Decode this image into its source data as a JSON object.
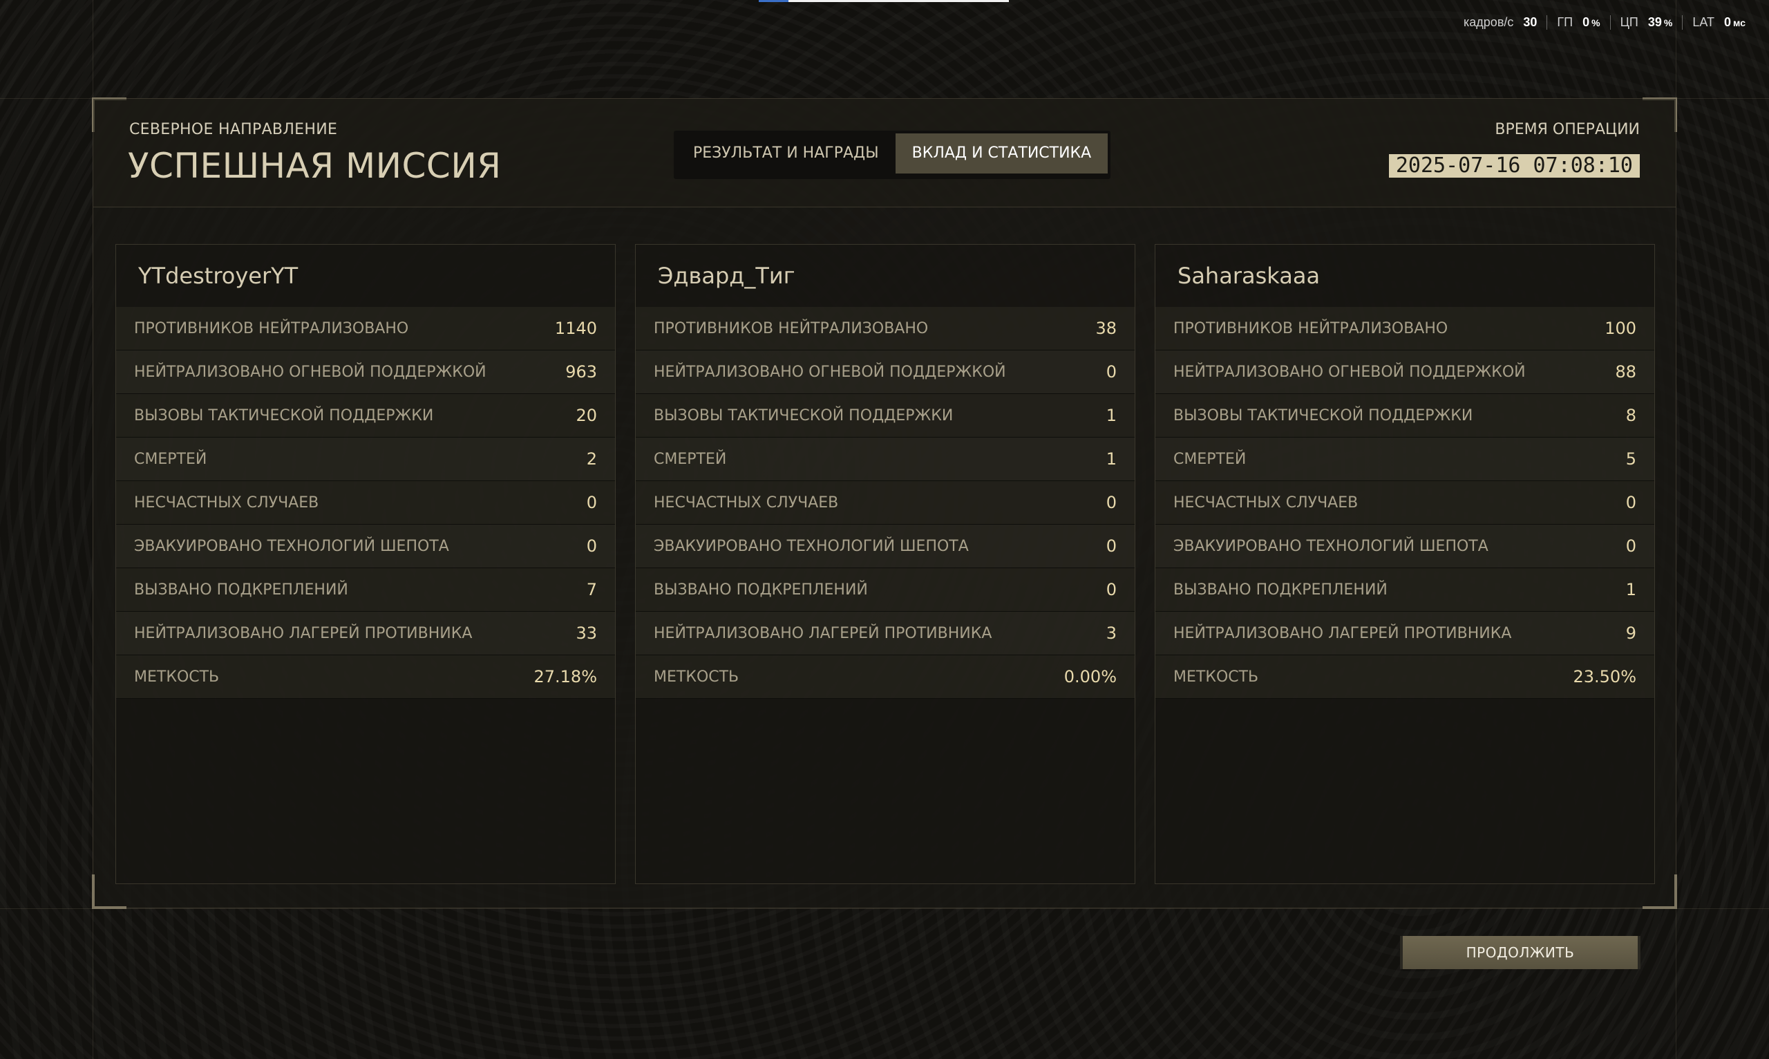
{
  "progress": {
    "fraction": 0.12
  },
  "perf": [
    {
      "label": "кадров/с",
      "value": "30",
      "unit": ""
    },
    {
      "label": "ГП",
      "value": "0",
      "unit": "%"
    },
    {
      "label": "ЦП",
      "value": "39",
      "unit": "%"
    },
    {
      "label": "LAT",
      "value": "0",
      "unit": "мс"
    }
  ],
  "header": {
    "subtitle": "СЕВЕРНОЕ НАПРАВЛЕНИЕ",
    "title": "УСПЕШНАЯ МИССИЯ",
    "op_time_label": "ВРЕМЯ ОПЕРАЦИИ",
    "op_time": "2025-07-16 07:08:10"
  },
  "tabs": [
    {
      "label": "РЕЗУЛЬТАТ И НАГРАДЫ",
      "active": false
    },
    {
      "label": "ВКЛАД И СТАТИСТИКА",
      "active": true
    }
  ],
  "players": [
    {
      "name": "YTdestroyerYT",
      "stats": [
        {
          "label": "Противников нейтрализовано",
          "value": "1140"
        },
        {
          "label": "Нейтрализовано огневой поддержкой",
          "value": "963"
        },
        {
          "label": "Вызовы тактической поддержки",
          "value": "20"
        },
        {
          "label": "Смертей",
          "value": "2"
        },
        {
          "label": "Несчастных случаев",
          "value": "0"
        },
        {
          "label": "Эвакуировано технологий шепота",
          "value": "0"
        },
        {
          "label": "Вызвано подкреплений",
          "value": "7"
        },
        {
          "label": "Нейтрализовано лагерей противника",
          "value": "33"
        },
        {
          "label": "Меткость",
          "value": "27.18%"
        }
      ]
    },
    {
      "name": "Эдвард_Тиг",
      "stats": [
        {
          "label": "Противников нейтрализовано",
          "value": "38"
        },
        {
          "label": "Нейтрализовано огневой поддержкой",
          "value": "0"
        },
        {
          "label": "Вызовы тактической поддержки",
          "value": "1"
        },
        {
          "label": "Смертей",
          "value": "1"
        },
        {
          "label": "Несчастных случаев",
          "value": "0"
        },
        {
          "label": "Эвакуировано технологий шепота",
          "value": "0"
        },
        {
          "label": "Вызвано подкреплений",
          "value": "0"
        },
        {
          "label": "Нейтрализовано лагерей противника",
          "value": "3"
        },
        {
          "label": "Меткость",
          "value": "0.00%"
        }
      ]
    },
    {
      "name": "Saharaskaaa",
      "stats": [
        {
          "label": "Противников нейтрализовано",
          "value": "100"
        },
        {
          "label": "Нейтрализовано огневой поддержкой",
          "value": "88"
        },
        {
          "label": "Вызовы тактической поддержки",
          "value": "8"
        },
        {
          "label": "Смертей",
          "value": "5"
        },
        {
          "label": "Несчастных случаев",
          "value": "0"
        },
        {
          "label": "Эвакуировано технологий шепота",
          "value": "0"
        },
        {
          "label": "Вызвано подкреплений",
          "value": "1"
        },
        {
          "label": "Нейтрализовано лагерей противника",
          "value": "9"
        },
        {
          "label": "Меткость",
          "value": "23.50%"
        }
      ]
    }
  ],
  "continue_label": "ПРОДОЛЖИТЬ"
}
